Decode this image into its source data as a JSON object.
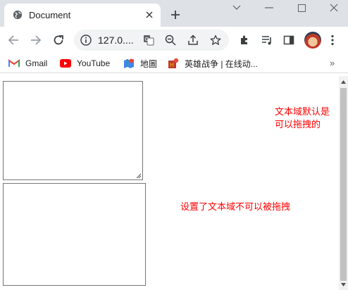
{
  "browser": {
    "tab_title": "Document",
    "url": "127.0....",
    "bookmarks": [
      {
        "label": "Gmail",
        "icon": "gmail-icon"
      },
      {
        "label": "YouTube",
        "icon": "youtube-icon"
      },
      {
        "label": "地圖",
        "icon": "maps-icon"
      },
      {
        "label": "英雄战争 | 在线动...",
        "icon": "game-icon"
      }
    ],
    "more_bookmarks": "»"
  },
  "page": {
    "note_resizable": "文本域默认是可以拖拽的",
    "note_fixed": "设置了文本域不可以被拖拽"
  },
  "colors": {
    "tabstrip": "#dee1e6",
    "note": "#ff0000",
    "textarea_border": "#767676"
  }
}
